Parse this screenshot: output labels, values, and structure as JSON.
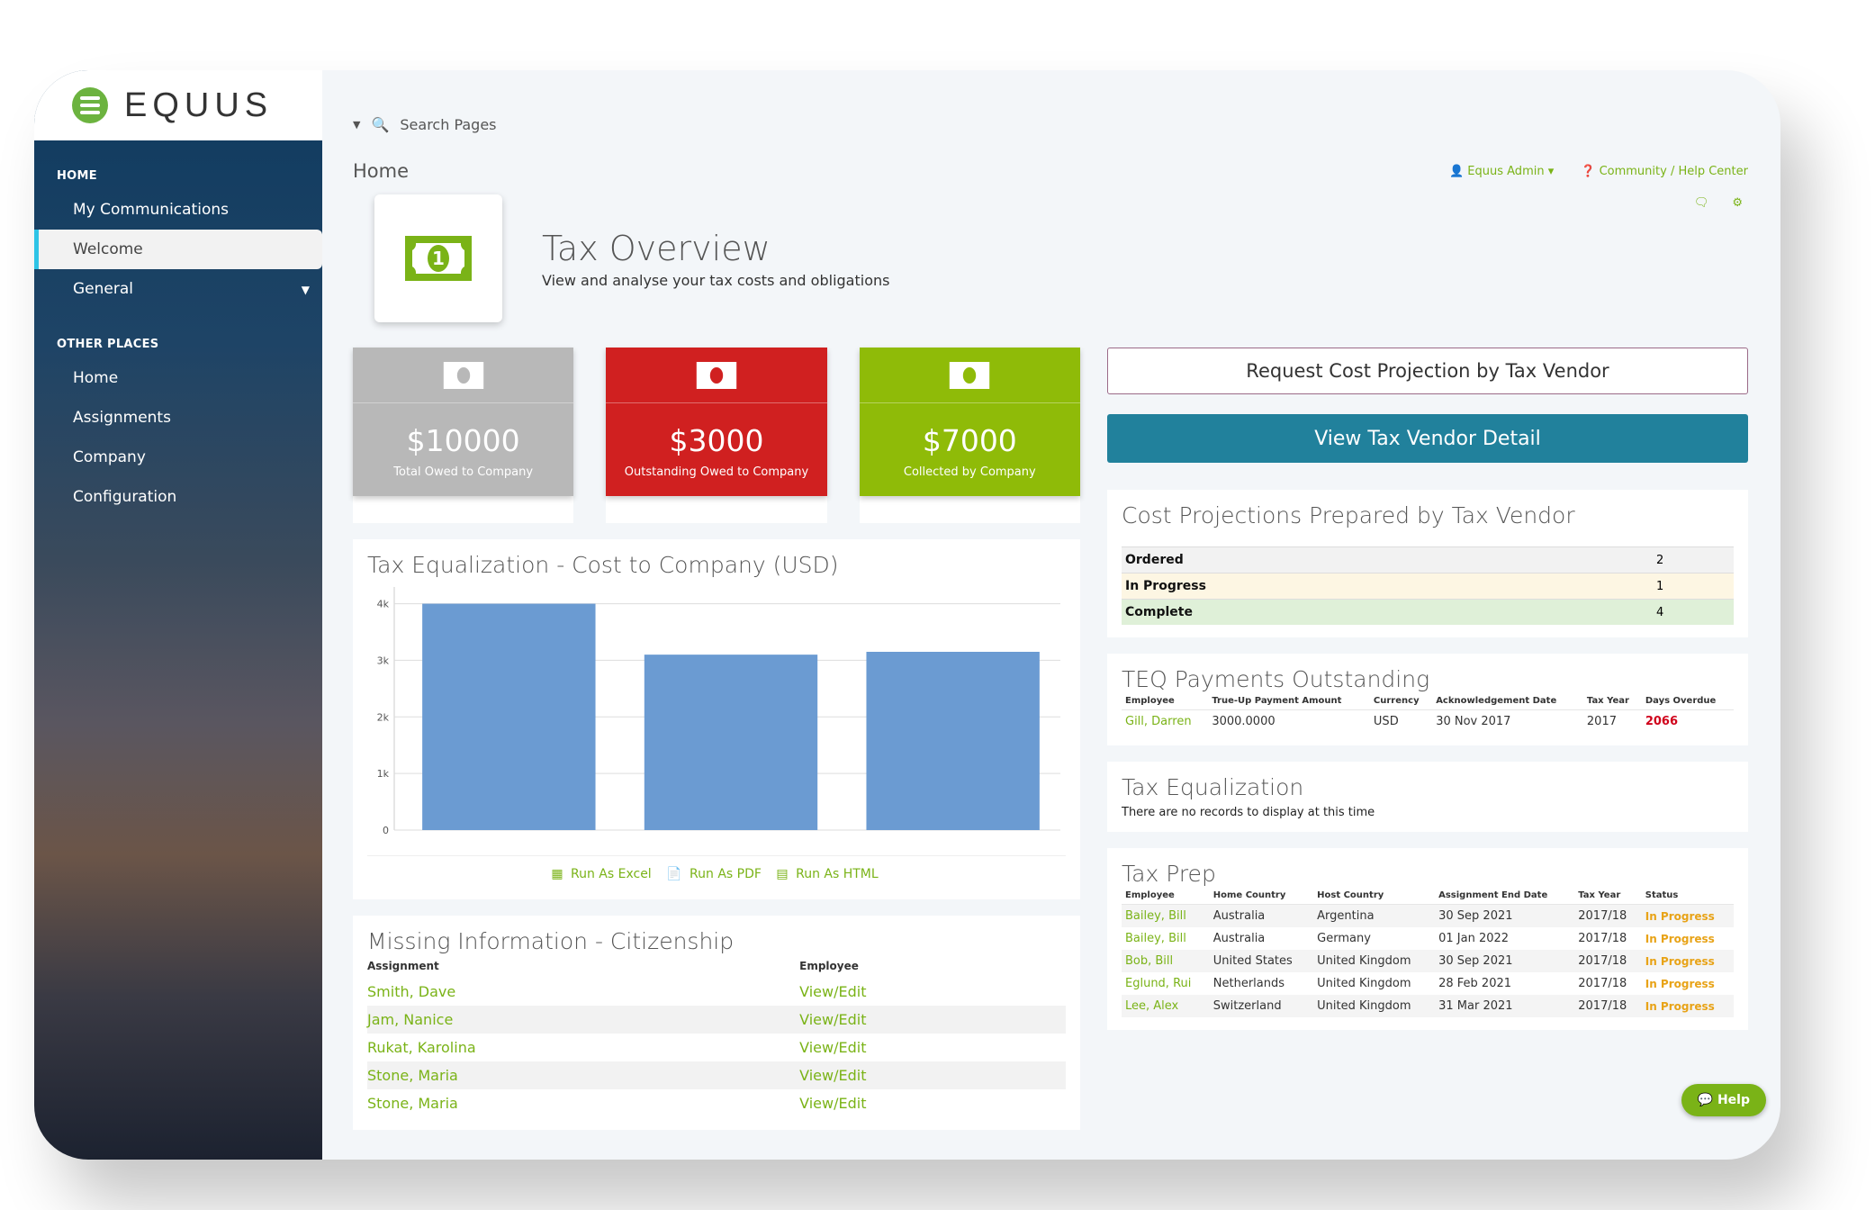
{
  "brand": {
    "name": "EQUUS",
    "accent": "#7ab317",
    "teal": "#21819c"
  },
  "sidebar": {
    "sections": [
      {
        "heading": "HOME",
        "items": [
          {
            "label": "My Communications",
            "active": false
          },
          {
            "label": "Welcome",
            "active": true
          },
          {
            "label": "General",
            "active": false,
            "icon": "chevron-down-icon"
          }
        ]
      },
      {
        "heading": "OTHER PLACES",
        "items": [
          {
            "label": "Home"
          },
          {
            "label": "Assignments"
          },
          {
            "label": "Company"
          },
          {
            "label": "Configuration"
          }
        ]
      }
    ]
  },
  "topbar": {
    "search_placeholder": "Search Pages",
    "breadcrumb": "Home",
    "user": "Equus Admin",
    "help_link": "Community / Help Center"
  },
  "header": {
    "title": "Tax Overview",
    "subtitle": "View and analyse your tax costs and obligations"
  },
  "kpis": [
    {
      "value": "$10000",
      "label": "Total Owed to Company",
      "color": "#b8b8b8"
    },
    {
      "value": "$3000",
      "label": "Outstanding Owed to Company",
      "color": "#d02020"
    },
    {
      "value": "$7000",
      "label": "Collected by Company",
      "color": "#8fbb08"
    }
  ],
  "chart_data": {
    "type": "bar",
    "title": "Tax Equalization - Cost to Company (USD)",
    "categories": [
      "",
      "",
      ""
    ],
    "values": [
      4000,
      3100,
      3150
    ],
    "yticks": [
      "0",
      "1k",
      "2k",
      "3k",
      "4k"
    ],
    "ylim": [
      0,
      4200
    ],
    "xlabel": "",
    "ylabel": "",
    "color": "#6b9bd2",
    "grid": true
  },
  "run_links": {
    "excel": "Run As Excel",
    "pdf": "Run As PDF",
    "html": "Run As HTML"
  },
  "missing_info": {
    "title": "Missing Information - Citizenship",
    "columns": [
      "Assignment",
      "Employee"
    ],
    "rows": [
      {
        "assignment": "Smith, Dave",
        "employee": "View/Edit"
      },
      {
        "assignment": "Jam, Nanice",
        "employee": "View/Edit"
      },
      {
        "assignment": "Rukat, Karolina",
        "employee": "View/Edit"
      },
      {
        "assignment": "Stone, Maria",
        "employee": "View/Edit"
      },
      {
        "assignment": "Stone, Maria",
        "employee": "View/Edit"
      }
    ]
  },
  "buttons": {
    "request": "Request Cost Projection by Tax Vendor",
    "view": "View Tax Vendor Detail"
  },
  "cost_projections": {
    "title": "Cost Projections Prepared by Tax Vendor",
    "rows": [
      {
        "label": "Ordered",
        "value": "2",
        "bg": "#f2f2f2"
      },
      {
        "label": "In Progress",
        "value": "1",
        "bg": "#fdf6e3"
      },
      {
        "label": "Complete",
        "value": "4",
        "bg": "#dff0d8"
      }
    ]
  },
  "teq": {
    "title": "TEQ Payments Outstanding",
    "columns": [
      "Employee",
      "True-Up Payment Amount",
      "Currency",
      "Acknowledgement Date",
      "Tax Year",
      "Days Overdue"
    ],
    "rows": [
      [
        "Gill, Darren",
        "3000.0000",
        "USD",
        "30 Nov 2017",
        "2017",
        "2066"
      ]
    ]
  },
  "tax_eq": {
    "title": "Tax Equalization",
    "empty": "There are no records to display at this time"
  },
  "tax_prep": {
    "title": "Tax Prep",
    "columns": [
      "Employee",
      "Home Country",
      "Host Country",
      "Assignment End Date",
      "Tax Year",
      "Status"
    ],
    "rows": [
      [
        "Bailey, Bill",
        "Australia",
        "Argentina",
        "30 Sep 2021",
        "2017/18",
        "In Progress"
      ],
      [
        "Bailey, Bill",
        "Australia",
        "Germany",
        "01 Jan 2022",
        "2017/18",
        "In Progress"
      ],
      [
        "Bob, Bill",
        "United States",
        "United Kingdom",
        "30 Sep 2021",
        "2017/18",
        "In Progress"
      ],
      [
        "Eglund, Rui",
        "Netherlands",
        "United Kingdom",
        "28 Feb 2021",
        "2017/18",
        "In Progress"
      ],
      [
        "Lee, Alex",
        "Switzerland",
        "United Kingdom",
        "31 Mar 2021",
        "2017/18",
        "In Progress"
      ]
    ]
  },
  "help_button": "Help"
}
